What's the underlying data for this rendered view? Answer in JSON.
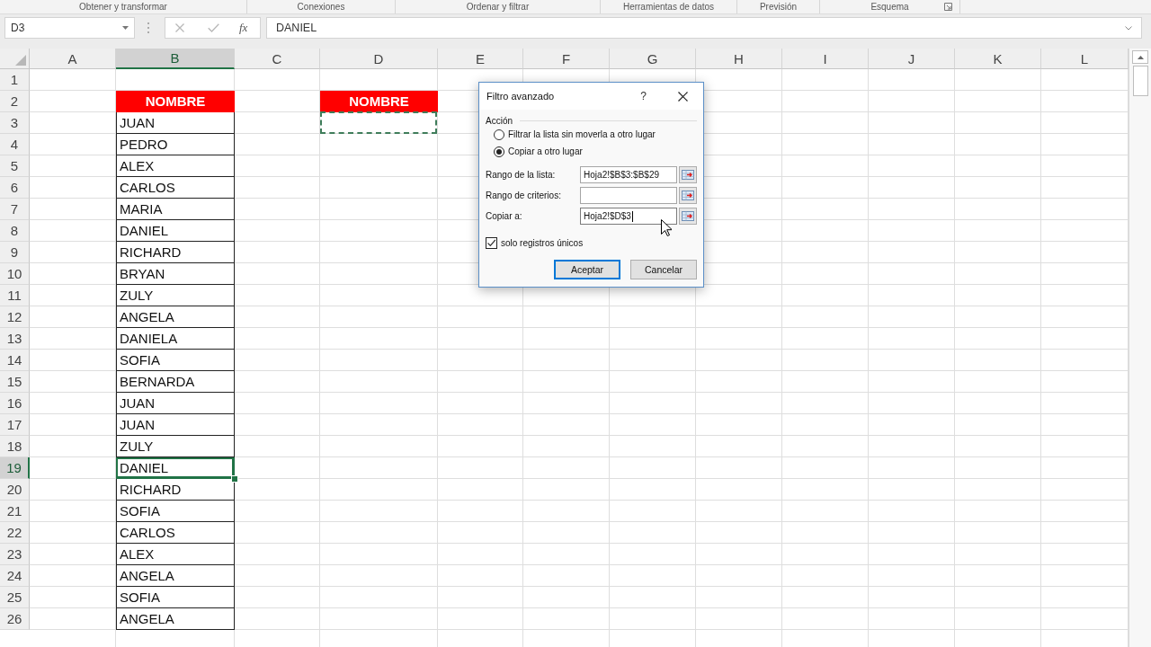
{
  "ribbon_groups": [
    {
      "label": "Obtener y transformar",
      "launcher": false
    },
    {
      "label": "Conexiones",
      "launcher": false
    },
    {
      "label": "Ordenar y filtrar",
      "launcher": false
    },
    {
      "label": "Herramientas de datos",
      "launcher": false
    },
    {
      "label": "Previsión",
      "launcher": false
    },
    {
      "label": "Esquema",
      "launcher": true
    }
  ],
  "formula_bar": {
    "name_box": "D3",
    "function_label": "fx",
    "formula": "DANIEL"
  },
  "sheet": {
    "columns": [
      {
        "label": "A",
        "selected": false
      },
      {
        "label": "B",
        "selected": true
      },
      {
        "label": "C",
        "selected": false
      },
      {
        "label": "D",
        "selected": false
      },
      {
        "label": "E",
        "selected": false
      },
      {
        "label": "F",
        "selected": false
      },
      {
        "label": "G",
        "selected": false
      },
      {
        "label": "H",
        "selected": false
      },
      {
        "label": "I",
        "selected": false
      },
      {
        "label": "J",
        "selected": false
      },
      {
        "label": "K",
        "selected": false
      },
      {
        "label": "L",
        "selected": false
      }
    ],
    "rows": [
      {
        "number": "1",
        "selected": false
      },
      {
        "number": "2",
        "selected": false,
        "column_b": {
          "text": "NOMBRE",
          "kind": "header",
          "selected": false
        },
        "column_d": {
          "text": "NOMBRE",
          "kind": "header",
          "selected": false
        }
      },
      {
        "number": "3",
        "selected": false,
        "column_b": {
          "text": "JUAN",
          "kind": "bordered",
          "selected": false
        },
        "column_d": {
          "kind": "marquee",
          "selected": false
        }
      },
      {
        "number": "4",
        "selected": false,
        "column_b": {
          "text": "PEDRO",
          "kind": "bordered",
          "selected": false
        }
      },
      {
        "number": "5",
        "selected": false,
        "column_b": {
          "text": "ALEX",
          "kind": "bordered",
          "selected": false
        }
      },
      {
        "number": "6",
        "selected": false,
        "column_b": {
          "text": "CARLOS",
          "kind": "bordered",
          "selected": false
        }
      },
      {
        "number": "7",
        "selected": false,
        "column_b": {
          "text": "MARIA",
          "kind": "bordered",
          "selected": false
        }
      },
      {
        "number": "8",
        "selected": false,
        "column_b": {
          "text": "DANIEL",
          "kind": "bordered",
          "selected": false
        }
      },
      {
        "number": "9",
        "selected": false,
        "column_b": {
          "text": "RICHARD",
          "kind": "bordered",
          "selected": false
        }
      },
      {
        "number": "10",
        "selected": false,
        "column_b": {
          "text": "BRYAN",
          "kind": "bordered",
          "selected": false
        }
      },
      {
        "number": "11",
        "selected": false,
        "column_b": {
          "text": "ZULY",
          "kind": "bordered",
          "selected": false
        }
      },
      {
        "number": "12",
        "selected": false,
        "column_b": {
          "text": "ANGELA",
          "kind": "bordered",
          "selected": false
        }
      },
      {
        "number": "13",
        "selected": false,
        "column_b": {
          "text": "DANIELA",
          "kind": "bordered",
          "selected": false
        }
      },
      {
        "number": "14",
        "selected": false,
        "column_b": {
          "text": "SOFIA",
          "kind": "bordered",
          "selected": false
        }
      },
      {
        "number": "15",
        "selected": false,
        "column_b": {
          "text": "BERNARDA",
          "kind": "bordered",
          "selected": false
        }
      },
      {
        "number": "16",
        "selected": false,
        "column_b": {
          "text": "JUAN",
          "kind": "bordered",
          "selected": false
        }
      },
      {
        "number": "17",
        "selected": false,
        "column_b": {
          "text": "JUAN",
          "kind": "bordered",
          "selected": false
        }
      },
      {
        "number": "18",
        "selected": false,
        "column_b": {
          "text": "ZULY",
          "kind": "bordered",
          "selected": false
        }
      },
      {
        "number": "19",
        "selected": true,
        "column_b": {
          "text": "DANIEL",
          "kind": "bordered",
          "selected": true
        }
      },
      {
        "number": "20",
        "selected": false,
        "column_b": {
          "text": "RICHARD",
          "kind": "bordered",
          "selected": false
        }
      },
      {
        "number": "21",
        "selected": false,
        "column_b": {
          "text": "SOFIA",
          "kind": "bordered",
          "selected": false
        }
      },
      {
        "number": "22",
        "selected": false,
        "column_b": {
          "text": "CARLOS",
          "kind": "bordered",
          "selected": false
        }
      },
      {
        "number": "23",
        "selected": false,
        "column_b": {
          "text": "ALEX",
          "kind": "bordered",
          "selected": false
        }
      },
      {
        "number": "24",
        "selected": false,
        "column_b": {
          "text": "ANGELA",
          "kind": "bordered",
          "selected": false
        }
      },
      {
        "number": "25",
        "selected": false,
        "column_b": {
          "text": "SOFIA",
          "kind": "bordered",
          "selected": false
        }
      },
      {
        "number": "26",
        "selected": false,
        "column_b": {
          "text": "ANGELA",
          "kind": "bordered",
          "selected": false
        }
      }
    ]
  },
  "dialog": {
    "title": "Filtro avanzado",
    "help": "?",
    "group_label": "Acción",
    "options": [
      {
        "label": "Filtrar la lista sin moverla a otro lugar",
        "selected": false
      },
      {
        "label": "Copiar a otro lugar",
        "selected": true
      }
    ],
    "fields": [
      {
        "label": "Rango de la lista:",
        "value": "Hoja2!$B$3:$B$29",
        "focused": false
      },
      {
        "label": "Rango de criterios:",
        "focused": false
      },
      {
        "label": "Copiar a:",
        "value": "Hoja2!$D$3",
        "focused": true
      }
    ],
    "checkbox": {
      "label": "solo registros únicos",
      "checked": true
    },
    "buttons": [
      {
        "label": "Aceptar",
        "default": true
      },
      {
        "label": "Cancelar",
        "default": false
      }
    ]
  }
}
